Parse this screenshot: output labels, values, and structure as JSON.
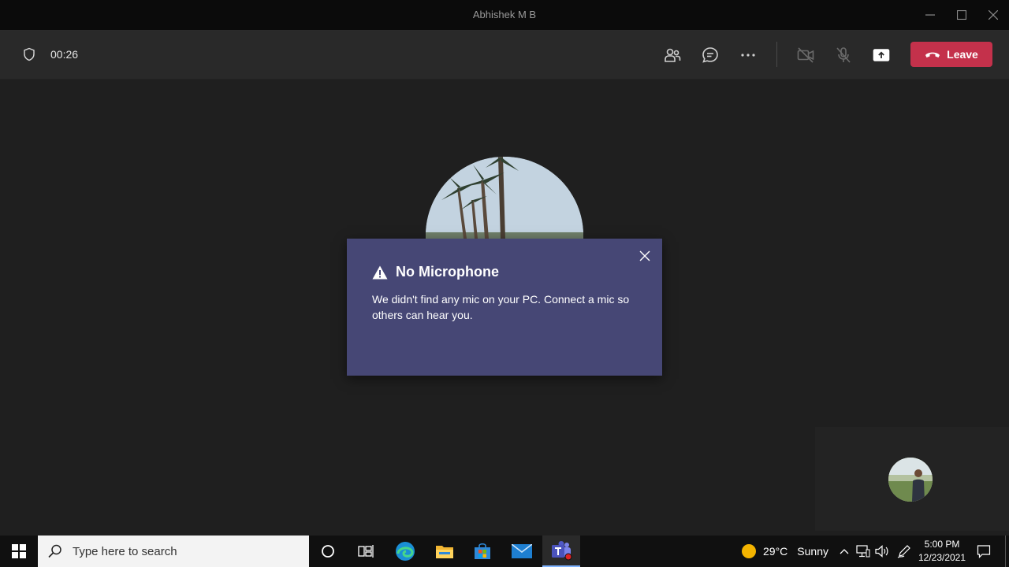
{
  "window": {
    "title": "Abhishek M B"
  },
  "call": {
    "timer": "00:26",
    "leave_label": "Leave",
    "leave_color": "#c4314b"
  },
  "dialog": {
    "title": "No Microphone",
    "message": "We didn't find any mic on your PC. Connect a mic so others can hear you.",
    "background": "#464775"
  },
  "taskbar": {
    "search_placeholder": "Type here to search",
    "weather": {
      "temp": "29°C",
      "condition": "Sunny"
    },
    "clock": {
      "time": "5:00 PM",
      "date": "12/23/2021"
    }
  },
  "icons": [
    "shield-icon",
    "people-icon",
    "chat-icon",
    "more-icon",
    "camera-off-icon",
    "mic-off-icon",
    "share-screen-icon",
    "phone-hangup-icon",
    "warning-icon",
    "close-icon",
    "windows-start-icon",
    "search-icon",
    "cortana-icon",
    "task-view-icon",
    "edge-icon",
    "file-explorer-icon",
    "store-icon",
    "mail-icon",
    "teams-icon",
    "sun-icon",
    "chevron-up-icon",
    "network-icon",
    "volume-icon",
    "pen-icon",
    "notification-icon"
  ]
}
